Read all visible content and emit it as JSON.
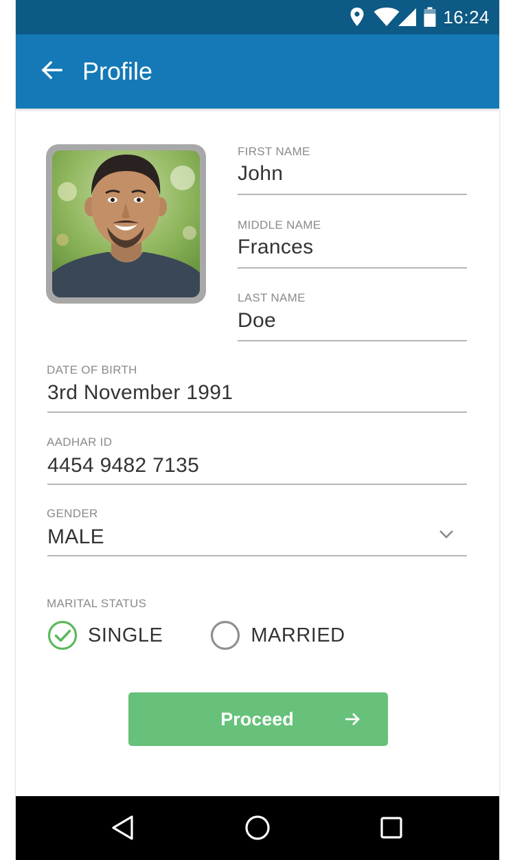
{
  "status_bar": {
    "time": "16:24",
    "icons": [
      "location-icon",
      "wifi-icon",
      "signal-icon",
      "battery-icon"
    ]
  },
  "app_bar": {
    "title": "Profile",
    "back_icon": "arrow-left-icon"
  },
  "form": {
    "first_name": {
      "label": "FIRST NAME",
      "value": "John"
    },
    "middle_name": {
      "label": "MIDDLE NAME",
      "value": "Frances"
    },
    "last_name": {
      "label": "LAST NAME",
      "value": "Doe"
    },
    "date_of_birth": {
      "label": "DATE OF BIRTH",
      "value": "3rd November 1991"
    },
    "aadhar_id": {
      "label": "AADHAR ID",
      "value": "4454 9482 7135"
    },
    "gender": {
      "label": "GENDER",
      "value": "MALE",
      "icon": "chevron-down-icon"
    },
    "marital_status": {
      "label": "MARITAL STATUS",
      "options": [
        {
          "label": "SINGLE",
          "selected": true
        },
        {
          "label": "MARRIED",
          "selected": false
        }
      ]
    }
  },
  "proceed_button": {
    "label": "Proceed",
    "icon": "arrow-right-icon"
  },
  "nav_bar": {
    "icons": [
      "back-triangle-icon",
      "home-circle-icon",
      "recents-square-icon"
    ]
  },
  "colors": {
    "status_bar": "#0c5a85",
    "app_bar": "#1479b6",
    "accent_green": "#67c17a",
    "check_green": "#5cb85c",
    "label_gray": "#8a8a8a",
    "text": "#333333"
  }
}
